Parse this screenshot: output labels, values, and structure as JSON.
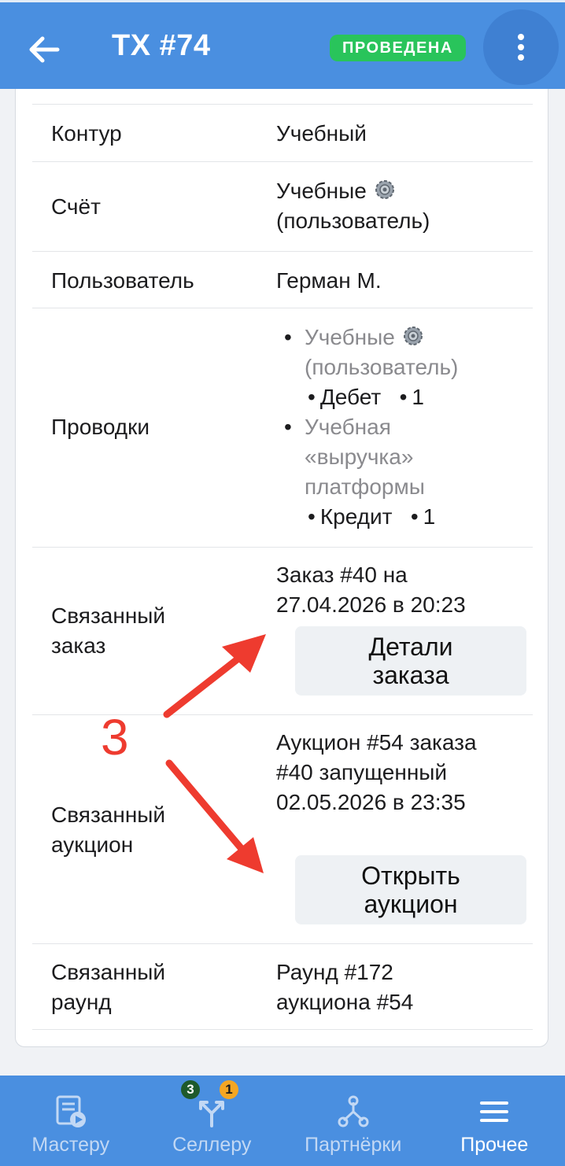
{
  "header": {
    "title": "TX #74",
    "status": "ПРОВЕДЕНА",
    "back_icon": "arrow-left-icon",
    "menu_icon": "more-vertical-icon"
  },
  "details": {
    "contour": {
      "label": "Контур",
      "value": "Учебный"
    },
    "account": {
      "label": "Счёт",
      "value_line1": "Учебные",
      "value_line2": "(пользователь)"
    },
    "user": {
      "label": "Пользователь",
      "value": "Герман М."
    },
    "postings": {
      "label": "Проводки",
      "entries": [
        {
          "line1": "Учебные",
          "line2": "(пользователь)",
          "side": "Дебет",
          "amount": "1"
        },
        {
          "line1": "Учебная",
          "line2": "«выручка»",
          "line3": "платформы",
          "side": "Кредит",
          "amount": "1"
        }
      ]
    },
    "linked_order": {
      "label_line1": "Связанный",
      "label_line2": "заказ",
      "value_line1": "Заказ #40 на",
      "value_line2": "27.04.2026 в 20:23",
      "button_line1": "Детали",
      "button_line2": "заказа"
    },
    "linked_auction": {
      "label_line1": "Связанный",
      "label_line2": "аукцион",
      "value_line1": "Аукцион #54 заказа",
      "value_line2": "#40 запущенный",
      "value_line3": "02.05.2026 в 23:35",
      "button_line1": "Открыть",
      "button_line2": "аукцион"
    },
    "linked_round": {
      "label_line1": "Связанный",
      "label_line2": "раунд",
      "value_line1": "Раунд #172",
      "value_line2": "аукциона #54"
    }
  },
  "annotation": {
    "number": "3",
    "color": "#ee3b2f"
  },
  "bottom_nav": {
    "items": [
      {
        "label": "Мастеру",
        "icon": "master-doc-icon"
      },
      {
        "label": "Селлеру",
        "icon": "split-arrows-icon",
        "badge_green": "3",
        "badge_orange": "1"
      },
      {
        "label": "Партнёрки",
        "icon": "network-icon"
      },
      {
        "label": "Прочее",
        "icon": "hamburger-menu-icon",
        "active": true
      }
    ]
  },
  "colors": {
    "header_bg": "#4a8fe0",
    "status_green": "#29c45b",
    "annotation_red": "#ee3b2f"
  }
}
